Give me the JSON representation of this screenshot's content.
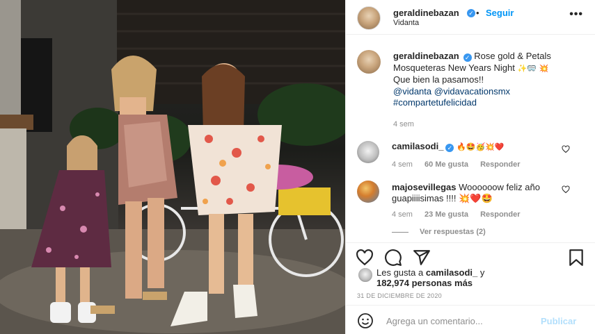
{
  "post": {
    "username": "geraldinebazan",
    "verified_icon": "verified-badge-icon",
    "follow_label": "Seguir",
    "separator": "•",
    "location": "Vidanta",
    "more_icon": "more-options-icon",
    "more_glyph": "•••"
  },
  "caption": {
    "username": "geraldinebazan",
    "line1": "Rose gold & Petals Mosqueteras New Years Night",
    "line1_emoji": "✨🥽",
    "line2_emoji": "💥",
    "line3": "Que bien la pasamos!!",
    "mention1": "@vidanta",
    "mention2": "@vidavacationsmx",
    "hashtag": "#compartetufelicidad",
    "time": "4 sem"
  },
  "comments": [
    {
      "username": "camilasodi_",
      "text": "🔥🤩🥳💥❤️",
      "time": "4 sem",
      "likes": "60 Me gusta",
      "reply": "Responder"
    },
    {
      "username": "majosevillegas",
      "text": "Woooooow feliz año guapiiiisimas !!!! 💥❤️🤩",
      "time": "4 sem",
      "likes": "23 Me gusta",
      "reply": "Responder"
    }
  ],
  "replies_label": "Ver respuestas (2)",
  "likes": {
    "prefix": "Les gusta a",
    "user": "camilasodi_",
    "and": "y",
    "count": "182,974 personas más"
  },
  "date": "31 DE DICIEMBRE DE 2020",
  "composer": {
    "placeholder": "Agrega un comentario...",
    "publish_label": "Publicar"
  },
  "colors": {
    "accent": "#0095f6",
    "verified": "#3897f0",
    "link": "#00376b",
    "muted": "#8e8e8e",
    "publish_disabled": "#b2dffc"
  }
}
